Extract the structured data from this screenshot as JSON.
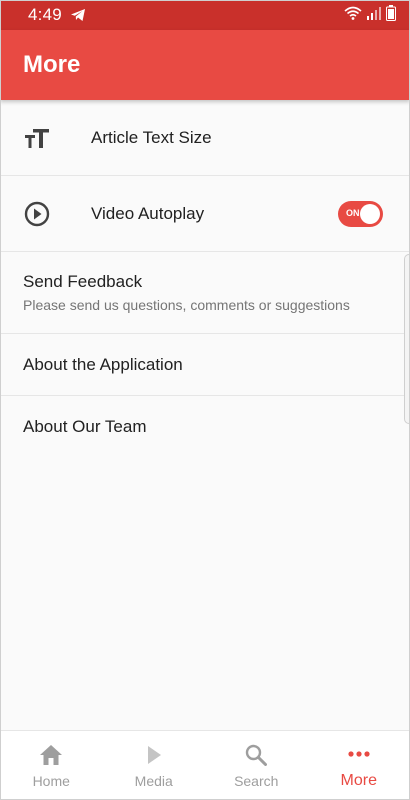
{
  "status_bar": {
    "time": "4:49"
  },
  "header": {
    "title": "More"
  },
  "settings": {
    "text_size_label": "Article Text Size",
    "video_autoplay_label": "Video Autoplay",
    "video_autoplay_state": "ON",
    "feedback_label": "Send Feedback",
    "feedback_subtitle": "Please send us questions, comments or suggestions",
    "about_app_label": "About the Application",
    "about_team_label": "About Our Team"
  },
  "bottom_nav": {
    "items": [
      {
        "label": "Home",
        "icon": "home-icon"
      },
      {
        "label": "Media",
        "icon": "play-icon"
      },
      {
        "label": "Search",
        "icon": "search-icon"
      },
      {
        "label": "More",
        "icon": "more-dots-icon"
      }
    ],
    "active_index": 3
  },
  "colors": {
    "brand_red": "#e84a43",
    "status_bar_red": "#c9302b",
    "inactive_gray": "#9e9e9e"
  }
}
